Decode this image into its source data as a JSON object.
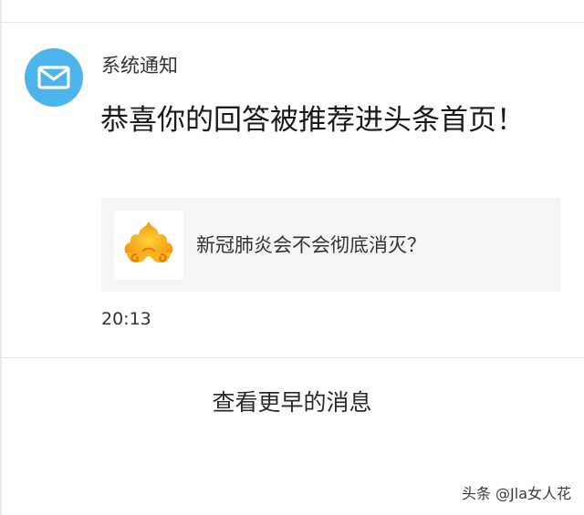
{
  "notification": {
    "icon": "mail-icon",
    "accent_color": "#4db4ea",
    "sender": "系统通知",
    "title": "恭喜你的回答被推荐进头条首页！",
    "article": {
      "thumbnail_icon": "golden-cloud-logo-icon",
      "title": "新冠肺炎会不会彻底消灭？"
    },
    "time": "20:13"
  },
  "footer": {
    "more_label": "查看更早的消息"
  },
  "watermark": {
    "text": "头条 @Jla女人花"
  }
}
